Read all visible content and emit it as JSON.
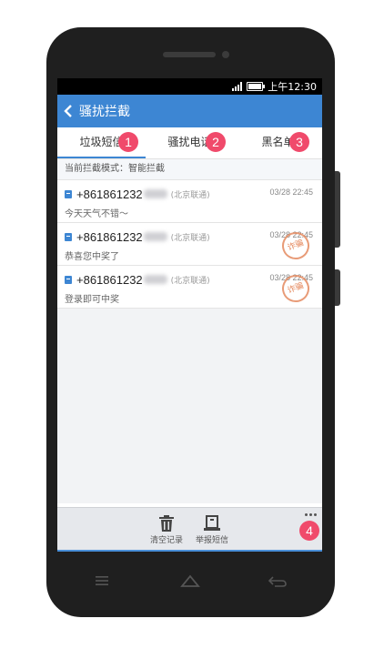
{
  "status": {
    "time": "上午12:30"
  },
  "header": {
    "title": "骚扰拦截"
  },
  "tabs": [
    {
      "label": "垃圾短信",
      "active": true
    },
    {
      "label": "骚扰电话",
      "active": false
    },
    {
      "label": "黑名单",
      "active": false
    }
  ],
  "callouts": [
    "1",
    "2",
    "3",
    "4"
  ],
  "mode_text": "当前拦截模式：智能拦截",
  "messages": [
    {
      "number": "+861861232",
      "carrier": "(北京联通)",
      "time": "03/28 22:45",
      "preview": "今天天气不错～",
      "stamp": ""
    },
    {
      "number": "+861861232",
      "carrier": "(北京联通)",
      "time": "03/28 22:45",
      "preview": "恭喜您中奖了",
      "stamp": "诈骗"
    },
    {
      "number": "+861861232",
      "carrier": "(北京联通)",
      "time": "03/28 22:45",
      "preview": "登录即可中奖",
      "stamp": "诈骗"
    }
  ],
  "bottom": {
    "clear_label": "清空记录",
    "report_label": "举报短信"
  },
  "colors": {
    "accent": "#3d86d3",
    "badge": "#f04a6b",
    "stamp": "#e0703c"
  }
}
